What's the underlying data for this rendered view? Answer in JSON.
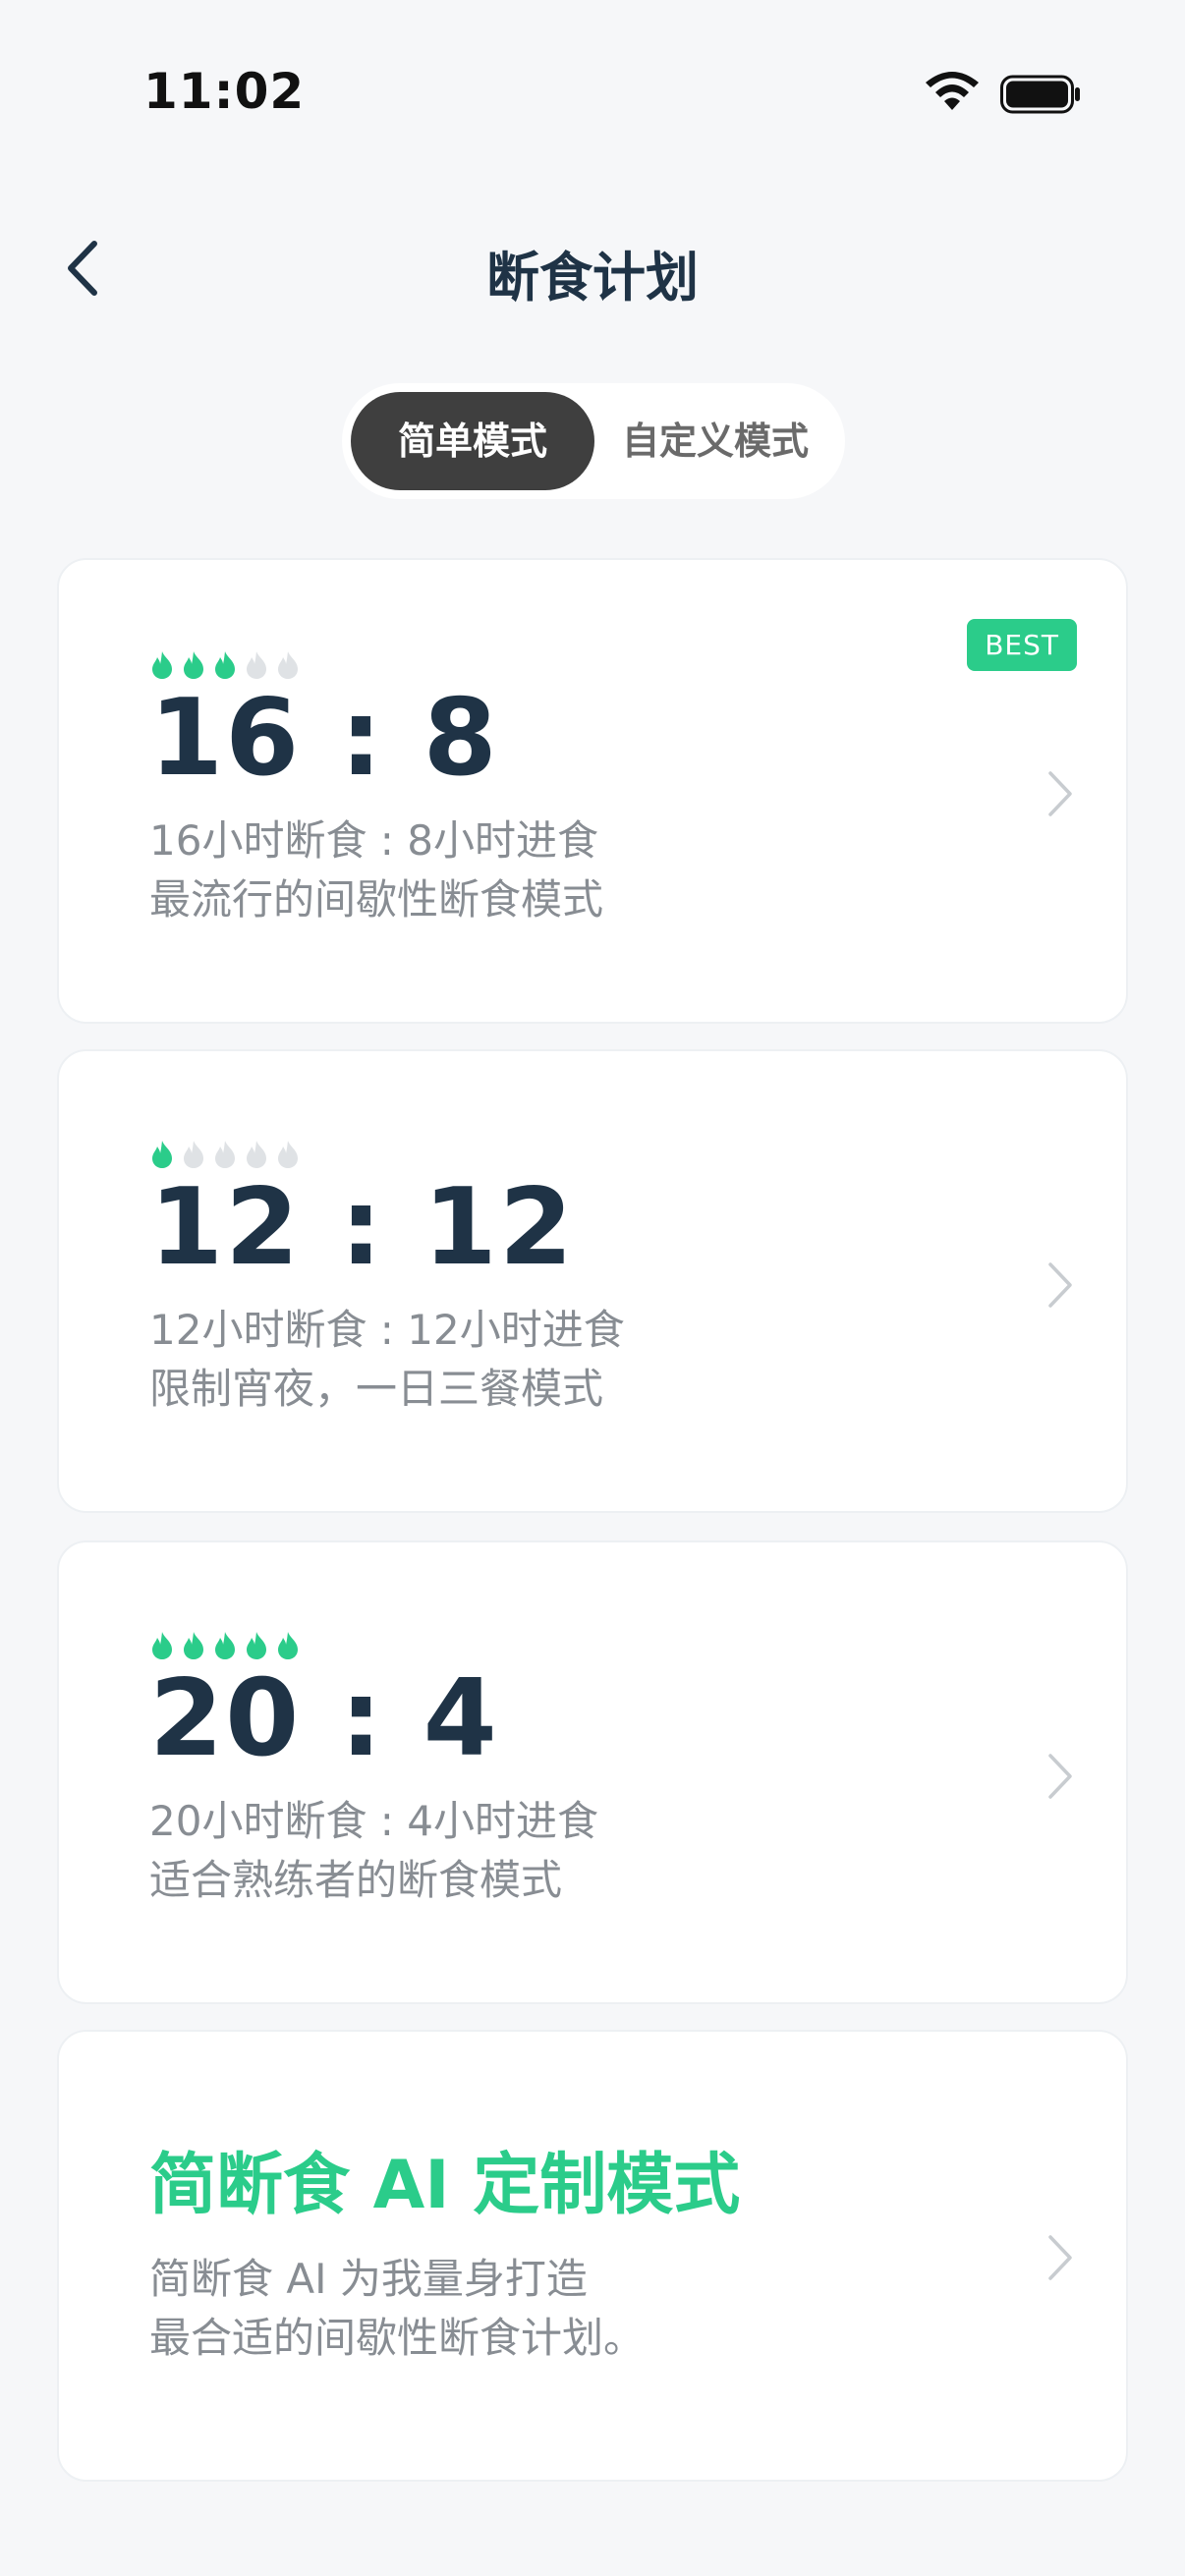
{
  "status": {
    "time": "11:02"
  },
  "nav": {
    "title": "断食计划"
  },
  "tabs": [
    {
      "label": "简单模式",
      "active": true
    },
    {
      "label": "自定义模式",
      "active": false
    }
  ],
  "plans": [
    {
      "ratio": "16 : 8",
      "line1": "16小时断食 : 8小时进食",
      "line2": "最流行的间歇性断食模式",
      "difficulty": 3,
      "max_difficulty": 5,
      "badge": "BEST"
    },
    {
      "ratio": "12 : 12",
      "line1": "12小时断食 : 12小时进食",
      "line2": "限制宵夜，一日三餐模式",
      "difficulty": 1,
      "max_difficulty": 5
    },
    {
      "ratio": "20 : 4",
      "line1": "20小时断食 : 4小时进食",
      "line2": "适合熟练者的断食模式",
      "difficulty": 5,
      "max_difficulty": 5
    }
  ],
  "ai_plan": {
    "title": "简断食 AI 定制模式",
    "line1": "简断食 AI 为我量身打造",
    "line2": "最合适的间歇性断食计划。"
  },
  "colors": {
    "accent": "#2bcc8a",
    "flame_inactive": "#dfe2e5",
    "text_primary": "#1f3346",
    "text_secondary": "#888d93"
  }
}
